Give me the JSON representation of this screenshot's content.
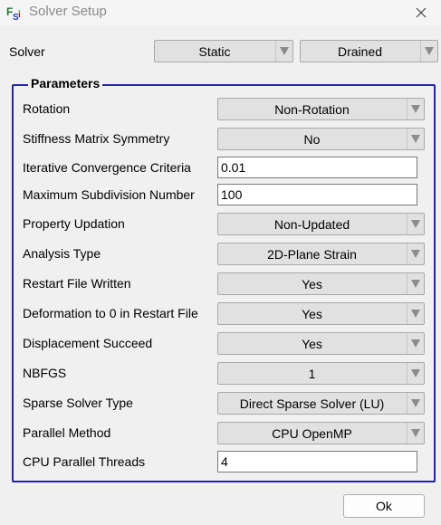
{
  "window": {
    "title": "Solver Setup",
    "icon_text": "FSI"
  },
  "solver": {
    "label": "Solver",
    "type_value": "Static",
    "drainage_value": "Drained"
  },
  "parameters": {
    "title": "Parameters",
    "rows": [
      {
        "label": "Rotation",
        "control": "combo",
        "value": "Non-Rotation"
      },
      {
        "label": "Stiffness Matrix Symmetry",
        "control": "combo",
        "value": "No"
      },
      {
        "label": "Iterative Convergence Criteria",
        "control": "text",
        "value": "0.01"
      },
      {
        "label": "Maximum Subdivision Number",
        "control": "text",
        "value": "100"
      },
      {
        "label": "Property Updation",
        "control": "combo",
        "value": "Non-Updated"
      },
      {
        "label": "Analysis Type",
        "control": "combo",
        "value": "2D-Plane Strain"
      },
      {
        "label": "Restart File Written",
        "control": "combo",
        "value": "Yes"
      },
      {
        "label": "Deformation to 0 in Restart File",
        "control": "combo",
        "value": "Yes"
      },
      {
        "label": "Displacement Succeed",
        "control": "combo",
        "value": "Yes"
      },
      {
        "label": "NBFGS",
        "control": "combo",
        "value": "1"
      },
      {
        "label": "Sparse Solver Type",
        "control": "combo",
        "value": "Direct Sparse Solver (LU)"
      },
      {
        "label": "Parallel Method",
        "control": "combo",
        "value": "CPU OpenMP"
      },
      {
        "label": "CPU Parallel Threads",
        "control": "text",
        "value": "4"
      }
    ]
  },
  "buttons": {
    "ok_label": "Ok"
  },
  "colors": {
    "group_border": "#2323a8",
    "combo_bg": "#e1e1e1",
    "window_bg": "#f0f0f0"
  }
}
